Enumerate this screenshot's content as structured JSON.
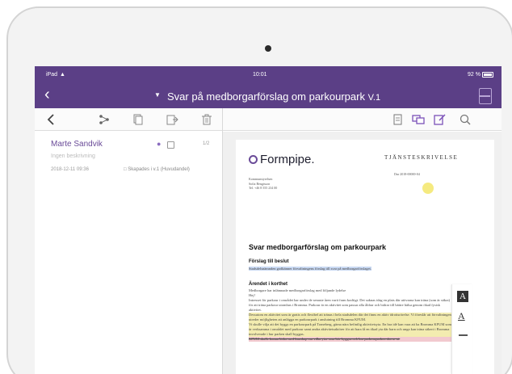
{
  "statusbar": {
    "carrier": "iPad",
    "time": "10:01",
    "indicators": "92 %"
  },
  "titlebar": {
    "title": "Svar på medborgarförslag om parkourpark",
    "version": "V.1"
  },
  "list": {
    "items": [
      {
        "name": "Marte Sandvik",
        "description": "Ingen beskrivning",
        "date": "2018-12-11 09:36",
        "created": "Skapades i v.1 (Huvudandel)",
        "pages": "1/2"
      }
    ]
  },
  "document": {
    "logo_text": "Formpipe.",
    "doc_type": "TJÄNSTESKRIVELSE",
    "doc_date": "Dnr 2018-00000-04",
    "sender_lines": [
      "Kommunstyrelsen",
      "Sofia Bengtsson",
      "Tel. +46 8 555 234 00"
    ],
    "heading": "Svar medborgarförslag om parkourpark",
    "section1_heading": "Förslag till beslut",
    "section1_text": "Stadsdelsnämnden godkänner förvaltningens förslag till svar på medborgarförslaget.",
    "section2_heading": "Ärendet i korthet",
    "section2_intro": "Medborgare har inlämnade medborgarförslag med följande lydelse",
    "section2_hej": "Hej!",
    "section2_text_a": "Intresset för parkour i området har under de senaste åren varit fram kraftigt. Det saknas idag en plats där utövarna kan träna (som är säkra) för att träna parkour utomhus i Bromma. Parkour är en aktivitet som passar alla åldrar och bidrar till bättre hälsa genom ökad fysisk aktivitet.",
    "section2_text_b": "Dessutom en aktivitet som är gratis och flexibel att tränas i hela stadsdelen där det finns en aktiv idrottsrörelse. Vi föreslår att förvaltningen utreder möjligheten att anlägga en parkourpark i anslutning till Bromma KFUM.",
    "section2_text_c": "Vi skulle vilja att det byggs en parkourpark på Traneberg, gärna nära befintlig aktivitetsyta. En bra idé kan vara att ha Bromma KFUM som är verksamma i området med parkour samt andra aktivitetsaktörer för att bara få en ökad yta där barn och unga kan träna säkert i Bromma involverade i hur parken skall byggas.",
    "section2_text_d": "KFUM skulle kunna bidra med kunskap om vilka ytor som bör byggas och hur parkourparken ska se ut."
  },
  "tools": {
    "text_highlight": "A",
    "text_underline": "A"
  },
  "colors": {
    "brand": "#5b3f86",
    "accent": "#6a4b98",
    "highlight_blue": "#c9d9f3",
    "highlight_yellow": "#f3ecb0",
    "highlight_red": "#f2c9cf"
  },
  "icons": {
    "back": "chevron-left-icon",
    "share": "share-icon",
    "copy": "copy-icon",
    "export": "export-icon",
    "delete": "trash-icon",
    "pages": "page-icon",
    "comments": "comments-icon",
    "annotate": "annotate-icon",
    "search": "search-icon"
  }
}
